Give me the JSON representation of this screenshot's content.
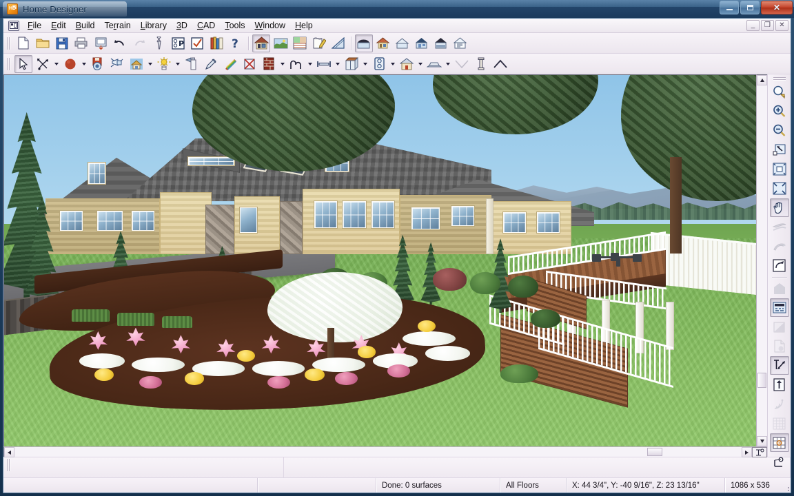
{
  "window": {
    "title": "Home Designer",
    "app_icon": "hd-logo-icon",
    "minimize_label": "Minimize",
    "maximize_label": "Maximize",
    "close_label": "Close"
  },
  "mdi": {
    "icon": "plan-window-icon",
    "minimize_label": "_",
    "restore_label": "❐",
    "close_label": "✕"
  },
  "menu": {
    "items": [
      {
        "label": "File",
        "accel": "F"
      },
      {
        "label": "Edit",
        "accel": "E"
      },
      {
        "label": "Build",
        "accel": "B"
      },
      {
        "label": "Terrain",
        "accel": "r"
      },
      {
        "label": "Library",
        "accel": "L"
      },
      {
        "label": "3D",
        "accel": "3"
      },
      {
        "label": "CAD",
        "accel": "C"
      },
      {
        "label": "Tools",
        "accel": "T"
      },
      {
        "label": "Window",
        "accel": "W"
      },
      {
        "label": "Help",
        "accel": "H"
      }
    ]
  },
  "toolbar_top": {
    "groups": [
      {
        "buttons": [
          {
            "name": "new-plan-button",
            "icon": "new-document-icon",
            "state": "normal"
          },
          {
            "name": "open-plan-button",
            "icon": "open-folder-icon",
            "state": "normal"
          },
          {
            "name": "save-plan-button",
            "icon": "save-disk-icon",
            "state": "normal"
          },
          {
            "name": "print-button",
            "icon": "printer-icon",
            "state": "normal"
          },
          {
            "name": "print-preview-button",
            "icon": "print-preview-icon",
            "state": "normal"
          },
          {
            "name": "undo-button",
            "icon": "undo-arrow-icon",
            "state": "normal"
          },
          {
            "name": "redo-button",
            "icon": "redo-arrow-icon",
            "state": "disabled"
          },
          {
            "name": "preferences-button",
            "icon": "wrench-icon",
            "state": "normal"
          },
          {
            "name": "plan-defaults-button",
            "icon": "preferences-p-icon",
            "state": "normal"
          },
          {
            "name": "check-button",
            "icon": "checkbox-icon",
            "state": "normal"
          },
          {
            "name": "library-browser-button",
            "icon": "library-books-icon",
            "state": "normal"
          },
          {
            "name": "help-button",
            "icon": "question-help-icon",
            "state": "normal"
          }
        ]
      },
      {
        "buttons": [
          {
            "name": "floor-plan-view-button",
            "icon": "house-front-icon",
            "state": "pressed"
          },
          {
            "name": "terrain-view-button",
            "icon": "landscape-icon",
            "state": "normal"
          },
          {
            "name": "material-list-button",
            "icon": "materials-grid-icon",
            "state": "normal"
          },
          {
            "name": "edit-area-button",
            "icon": "pencil-paper-icon",
            "state": "normal"
          },
          {
            "name": "measure-button",
            "icon": "ruler-triangle-icon",
            "state": "normal"
          }
        ]
      },
      {
        "buttons": [
          {
            "name": "camera-view-button",
            "icon": "camera-house-icon",
            "state": "pressed"
          },
          {
            "name": "elevation-view-button",
            "icon": "house-elevation-icon",
            "state": "normal"
          },
          {
            "name": "overview-button",
            "icon": "house-overview-icon",
            "state": "normal"
          },
          {
            "name": "doll-house-view-button",
            "icon": "dollhouse-icon",
            "state": "normal"
          },
          {
            "name": "framing-overview-button",
            "icon": "framing-overview-icon",
            "state": "normal"
          },
          {
            "name": "cross-section-button",
            "icon": "cross-section-icon",
            "state": "normal"
          }
        ]
      }
    ]
  },
  "toolbar_second": {
    "buttons": [
      {
        "name": "select-objects-button",
        "icon": "select-arrow-icon",
        "state": "pressed",
        "dropdown": false
      },
      {
        "name": "transform-button",
        "icon": "transform-arrows-icon",
        "state": "normal",
        "dropdown": true
      },
      {
        "name": "primitive-button",
        "icon": "red-sphere-icon",
        "state": "normal",
        "dropdown": true
      },
      {
        "name": "save-camera-button",
        "icon": "save-camera-icon",
        "state": "normal",
        "dropdown": false
      },
      {
        "name": "spotlight-button",
        "icon": "spotlight-icon",
        "state": "normal",
        "dropdown": false
      },
      {
        "name": "house-tool-button",
        "icon": "house-yellow-icon",
        "state": "normal",
        "dropdown": true
      },
      {
        "name": "sun-angle-button",
        "icon": "sun-icon",
        "state": "normal",
        "dropdown": true
      },
      {
        "name": "paint-spray-button",
        "icon": "spray-can-icon",
        "state": "normal",
        "dropdown": false
      },
      {
        "name": "eyedropper-button",
        "icon": "eyedropper-icon",
        "state": "normal",
        "dropdown": false
      },
      {
        "name": "material-paint-button",
        "icon": "rainbow-material-icon",
        "state": "normal",
        "dropdown": false
      },
      {
        "name": "no-material-button",
        "icon": "cross-out-icon",
        "state": "normal",
        "dropdown": false
      },
      {
        "name": "wall-material-button",
        "icon": "wall-texture-icon",
        "state": "normal",
        "dropdown": true
      },
      {
        "name": "railing-button",
        "icon": "arch-railing-icon",
        "state": "normal",
        "dropdown": true
      },
      {
        "name": "dimension-button",
        "icon": "dimension-line-icon",
        "state": "normal",
        "dropdown": true
      },
      {
        "name": "cabinet-button",
        "icon": "cabinet-box-icon",
        "state": "normal",
        "dropdown": true
      },
      {
        "name": "electrical-button",
        "icon": "outlet-icon",
        "state": "normal",
        "dropdown": true
      },
      {
        "name": "room-button",
        "icon": "room-house-icon",
        "state": "normal",
        "dropdown": true
      },
      {
        "name": "deck-button",
        "icon": "deck-platform-icon",
        "state": "normal",
        "dropdown": true
      },
      {
        "name": "valley-roof-button",
        "icon": "chevron-down-roof-icon",
        "state": "normal",
        "dropdown": false
      },
      {
        "name": "column-button",
        "icon": "column-icon",
        "state": "normal",
        "dropdown": false
      },
      {
        "name": "gable-roof-button",
        "icon": "gable-roof-icon",
        "state": "normal",
        "dropdown": false
      }
    ]
  },
  "right_palette": {
    "buttons": [
      {
        "name": "zoom-window-button",
        "icon": "zoom-window-icon",
        "state": "normal"
      },
      {
        "name": "zoom-in-button",
        "icon": "zoom-in-icon",
        "state": "normal"
      },
      {
        "name": "zoom-out-button",
        "icon": "zoom-out-icon",
        "state": "normal"
      },
      {
        "name": "fill-window-button",
        "icon": "fill-window-icon",
        "state": "normal"
      },
      {
        "name": "fill-building-button",
        "icon": "fill-building-icon",
        "state": "normal"
      },
      {
        "name": "zoom-extents-button",
        "icon": "zoom-extents-icon",
        "state": "normal"
      },
      {
        "name": "pan-window-button",
        "icon": "pan-hand-icon",
        "state": "pressed"
      },
      {
        "name": "previous-view-button",
        "icon": "previous-view-icon",
        "state": "disabled"
      },
      {
        "name": "next-view-button",
        "icon": "next-view-icon",
        "state": "disabled"
      },
      {
        "name": "orbit-camera-button",
        "icon": "orbit-rotate-icon",
        "state": "normal"
      },
      {
        "name": "house-shape-button",
        "icon": "house-solid-icon",
        "state": "disabled"
      },
      {
        "name": "toggle-textures-button",
        "icon": "textures-toggle-icon",
        "state": "pressed"
      },
      {
        "name": "toggle-shadows-button",
        "icon": "shadow-toggle-icon",
        "state": "disabled"
      },
      {
        "name": "rendering-technique-button",
        "icon": "render-page-icon",
        "state": "disabled"
      },
      {
        "name": "tape-measure-button",
        "icon": "tape-measure-icon",
        "state": "pressed"
      },
      {
        "name": "up-one-floor-button",
        "icon": "up-arrow-floor-icon",
        "state": "normal"
      },
      {
        "name": "motion-capture-button",
        "icon": "motion-waves-icon",
        "state": "disabled"
      },
      {
        "name": "reference-grid-button",
        "icon": "grid-icon",
        "state": "disabled"
      },
      {
        "name": "snap-grid-button",
        "icon": "grid-target-icon",
        "state": "pressed"
      },
      {
        "name": "cad-point-button",
        "icon": "cad-point-icon",
        "state": "normal"
      }
    ]
  },
  "viewport": {
    "name": "3d-camera-view",
    "scene_description": "Full Camera 3D rendering of a two-story cream-sided craftsman home with grey shingle roof, landscaped flower bed, and elevated wood deck with white railings",
    "vertical_scrollbar": {
      "thumb_position_percent": 84
    },
    "horizontal_scrollbar": {
      "thumb_position_percent": 88
    }
  },
  "statusbar": {
    "left_pane": "",
    "second_pane": "",
    "message": "Done:  0 surfaces",
    "floor": "All Floors",
    "coordinates": "X: 44 3/4\",  Y: -40 9/16\",  Z: 23 13/16\"",
    "view_size": "1086 x 536"
  }
}
